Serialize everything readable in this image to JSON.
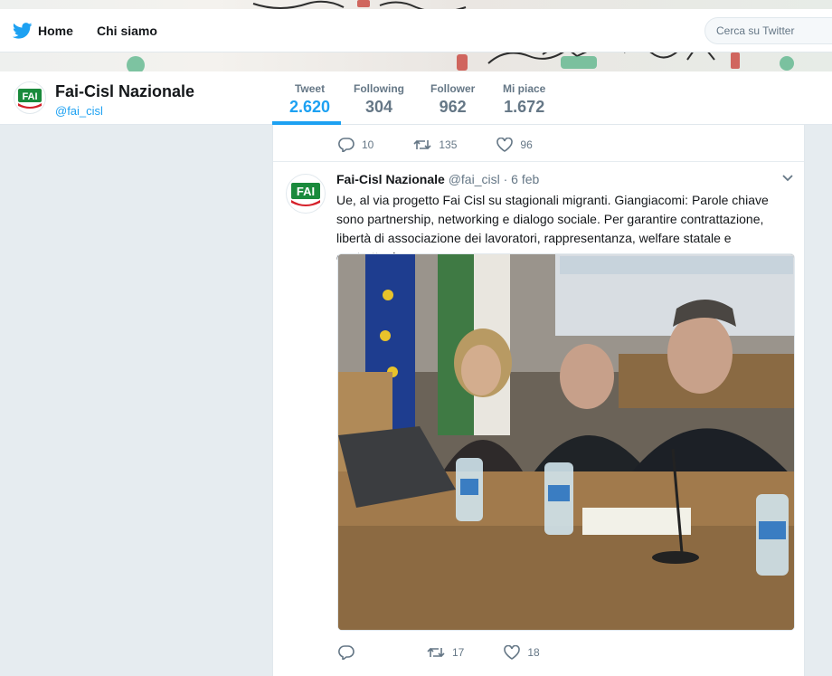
{
  "topnav": {
    "home_label": "Home",
    "chi_siamo_label": "Chi siamo",
    "search_placeholder": "Cerca su Twitter"
  },
  "profile": {
    "name": "Fai-Cisl Nazionale",
    "handle": "@fai_cisl",
    "avatar_text": "FAI",
    "stats": [
      {
        "label": "Tweet",
        "value": "2.620",
        "active": true
      },
      {
        "label": "Following",
        "value": "304"
      },
      {
        "label": "Follower",
        "value": "962"
      },
      {
        "label": "Mi piace",
        "value": "1.672"
      }
    ]
  },
  "prev_tweet": {
    "replies": "10",
    "retweets": "135",
    "likes": "96"
  },
  "tweet": {
    "name": "Fai-Cisl Nazionale",
    "handle": "@fai_cisl",
    "date": "· 6 feb",
    "text": "Ue, al via progetto Fai Cisl su stagionali migranti. Giangiacomi: Parole chiave sono partnership, networking e dialogo sociale. Per garantire contrattazione, libertà di associazione dei lavoratori, rappresentanza, welfare statale e contrattuale.",
    "replies": "",
    "retweets": "17",
    "likes": "18"
  },
  "colors": {
    "accent": "#1da1f2",
    "muted": "#657786",
    "background": "#e6ecf0",
    "logo_green": "#1a8a3c",
    "logo_red": "#d5202a"
  },
  "icons": [
    "twitter-bird-icon",
    "search-icon",
    "reply-icon",
    "retweet-icon",
    "like-icon",
    "chevron-down-icon"
  ]
}
